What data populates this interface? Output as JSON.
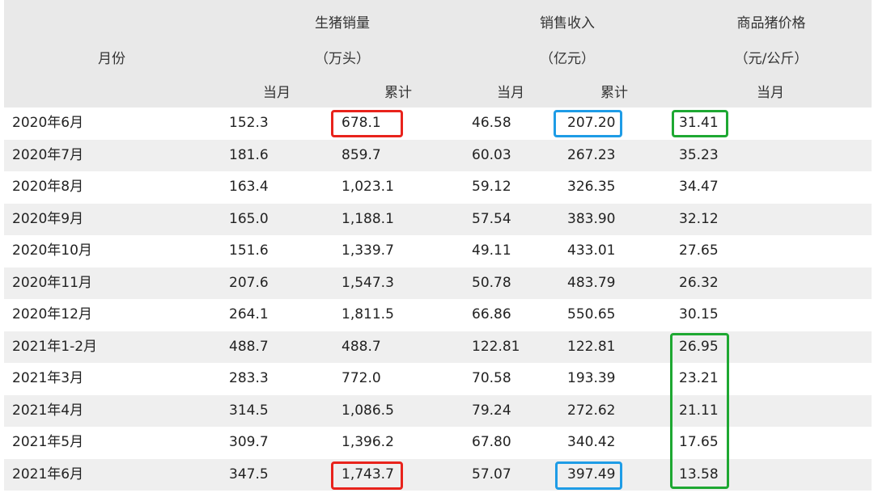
{
  "header": {
    "month": "月份",
    "sales_volume": "生猪销量",
    "sales_volume_unit": "（万头）",
    "revenue": "销售收入",
    "revenue_unit": "（亿元）",
    "price": "商品猪价格",
    "price_unit": "（元/公斤）",
    "current_month": "当月",
    "cumulative": "累计"
  },
  "rows": [
    {
      "month": "2020年6月",
      "vol": "152.3",
      "vol_cum": "678.1",
      "rev": "46.58",
      "rev_cum": "207.20",
      "price": "31.41"
    },
    {
      "month": "2020年7月",
      "vol": "181.6",
      "vol_cum": "859.7",
      "rev": "60.03",
      "rev_cum": "267.23",
      "price": "35.23"
    },
    {
      "month": "2020年8月",
      "vol": "163.4",
      "vol_cum": "1,023.1",
      "rev": "59.12",
      "rev_cum": "326.35",
      "price": "34.47"
    },
    {
      "month": "2020年9月",
      "vol": "165.0",
      "vol_cum": "1,188.1",
      "rev": "57.54",
      "rev_cum": "383.90",
      "price": "32.12"
    },
    {
      "month": "2020年10月",
      "vol": "151.6",
      "vol_cum": "1,339.7",
      "rev": "49.11",
      "rev_cum": "433.01",
      "price": "27.65"
    },
    {
      "month": "2020年11月",
      "vol": "207.6",
      "vol_cum": "1,547.3",
      "rev": "50.78",
      "rev_cum": "483.79",
      "price": "26.32"
    },
    {
      "month": "2020年12月",
      "vol": "264.1",
      "vol_cum": "1,811.5",
      "rev": "66.86",
      "rev_cum": "550.65",
      "price": "30.15"
    },
    {
      "month": "2021年1-2月",
      "vol": "488.7",
      "vol_cum": "488.7",
      "rev": "122.81",
      "rev_cum": "122.81",
      "price": "26.95"
    },
    {
      "month": "2021年3月",
      "vol": "283.3",
      "vol_cum": "772.0",
      "rev": "70.58",
      "rev_cum": "193.39",
      "price": "23.21"
    },
    {
      "month": "2021年4月",
      "vol": "314.5",
      "vol_cum": "1,086.5",
      "rev": "79.24",
      "rev_cum": "272.62",
      "price": "21.11"
    },
    {
      "month": "2021年5月",
      "vol": "309.7",
      "vol_cum": "1,396.2",
      "rev": "67.80",
      "rev_cum": "340.42",
      "price": "17.65"
    },
    {
      "month": "2021年6月",
      "vol": "347.5",
      "vol_cum": "1,743.7",
      "rev": "57.07",
      "rev_cum": "397.49",
      "price": "13.58"
    }
  ],
  "highlight_colors": {
    "red": "#e8231c",
    "blue": "#1e9ce6",
    "green": "#1ea832"
  }
}
